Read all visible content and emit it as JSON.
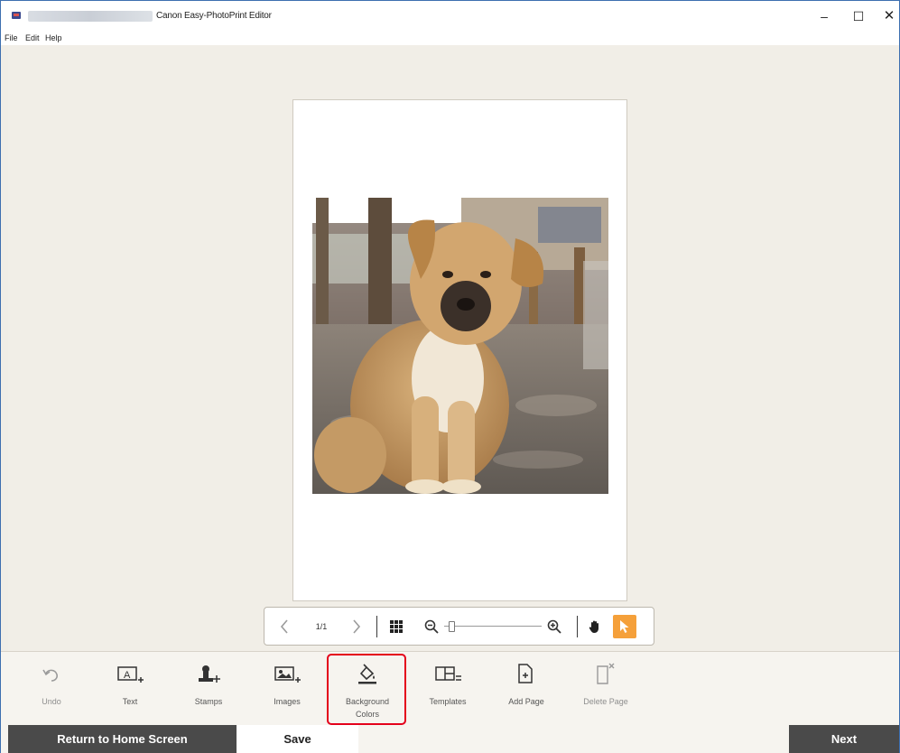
{
  "window": {
    "title": "Canon Easy-PhotoPrint Editor",
    "minimize": "–",
    "maximize": "☐",
    "close": "✕"
  },
  "menu": [
    "File",
    "Edit",
    "Help"
  ],
  "zoom_toolbar": {
    "page_indicator": "1/1",
    "zoom_level": 0.05
  },
  "tools": [
    {
      "label": "Undo",
      "icon": "undo-icon",
      "enabled": false
    },
    {
      "label": "Text",
      "icon": "add-text-icon",
      "enabled": true
    },
    {
      "label": "Stamps",
      "icon": "stamps-icon",
      "enabled": true
    },
    {
      "label": "Images",
      "icon": "images-icon",
      "enabled": true
    },
    {
      "label": "Background Colors",
      "icon": "background-colors-icon",
      "enabled": true,
      "highlighted": true
    },
    {
      "label": "Templates",
      "icon": "templates-icon",
      "enabled": true
    },
    {
      "label": "Add Page",
      "icon": "add-page-icon",
      "enabled": true
    },
    {
      "label": "Delete Page",
      "icon": "delete-page-icon",
      "enabled": false
    }
  ],
  "footer": {
    "home_label": "Return to Home Screen",
    "save_label": "Save",
    "next_label": "Next"
  },
  "colors": {
    "accent_orange": "#f5a03a",
    "highlight_red": "#e4001b",
    "dark_button": "#4a4a4a"
  }
}
